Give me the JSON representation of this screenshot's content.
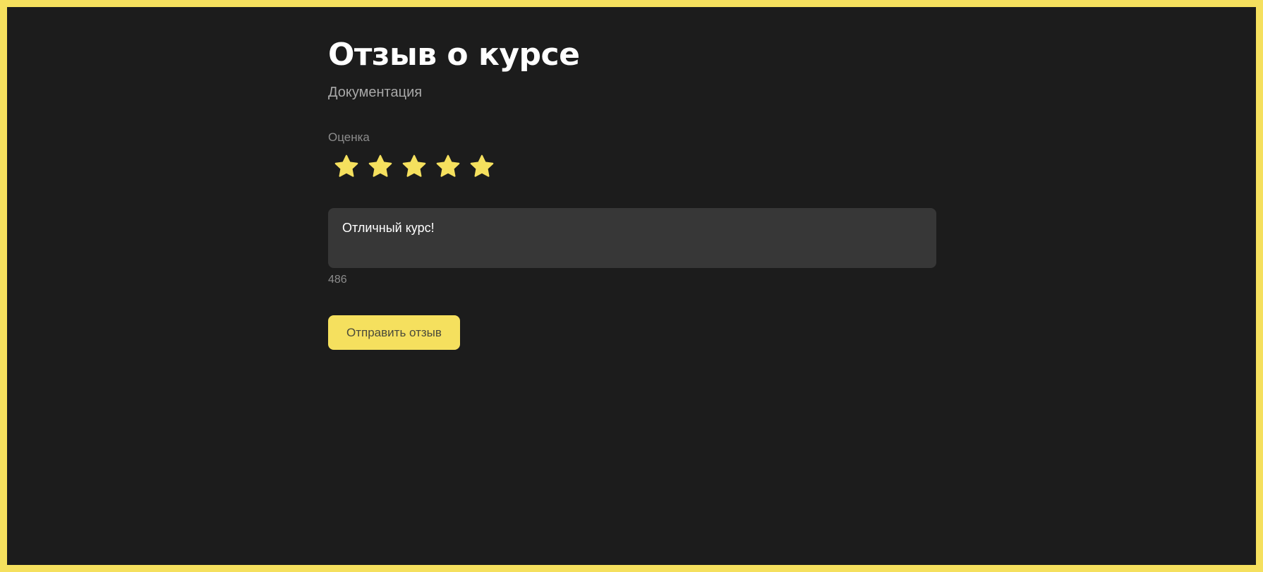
{
  "page": {
    "title": "Отзыв о курсе",
    "subtitle": "Документация"
  },
  "rating": {
    "label": "Оценка",
    "value": 5,
    "max": 5,
    "star_color": "#f5e05e"
  },
  "review": {
    "text": "Отличный курс!",
    "remaining_chars": "486"
  },
  "actions": {
    "submit_label": "Отправить отзыв"
  },
  "theme": {
    "border_color": "#f5e05e",
    "background": "#1c1c1c",
    "input_background": "#373737"
  }
}
